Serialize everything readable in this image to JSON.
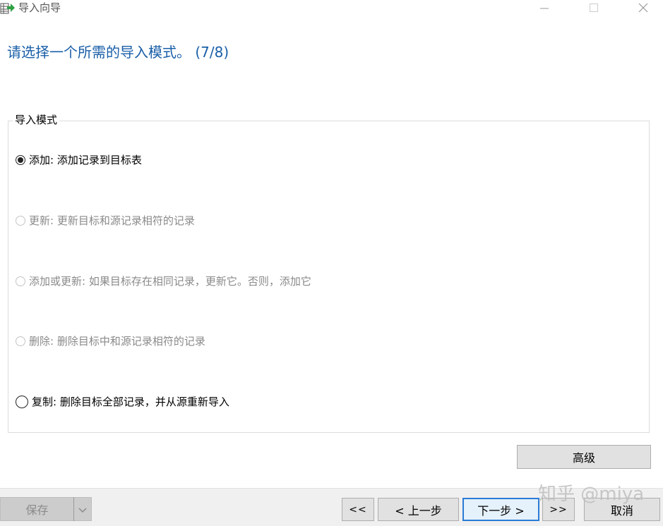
{
  "window": {
    "title": "导入向导",
    "icon": "table-import-icon",
    "controls": {
      "minimize": "minimize-icon",
      "maximize": "maximize-icon",
      "close": "close-icon"
    }
  },
  "header": {
    "step_title": "请选择一个所需的导入模式。 (7/8)"
  },
  "import_mode": {
    "group_label": "导入模式",
    "selected_index": 0,
    "options": [
      {
        "label": "添加: 添加记录到目标表",
        "selected": true,
        "enabled": true
      },
      {
        "label": "更新: 更新目标和源记录相符的记录",
        "selected": false,
        "enabled": false
      },
      {
        "label": "添加或更新: 如果目标存在相同记录，更新它。否则，添加它",
        "selected": false,
        "enabled": false
      },
      {
        "label": "删除: 删除目标中和源记录相符的记录",
        "selected": false,
        "enabled": false
      },
      {
        "label": "复制: 删除目标全部记录，并从源重新导入",
        "selected": false,
        "enabled": true
      }
    ]
  },
  "buttons": {
    "advanced": "高级",
    "save": "保存",
    "first": "<<",
    "prev": "< 上一步",
    "next": "下一步 >",
    "last": ">>",
    "cancel": "取消"
  },
  "watermark": "知乎 @miya",
  "colors": {
    "title_blue": "#1a5fa8",
    "focus_blue": "#2a7bd6",
    "disabled_text": "#8a8a8a"
  }
}
